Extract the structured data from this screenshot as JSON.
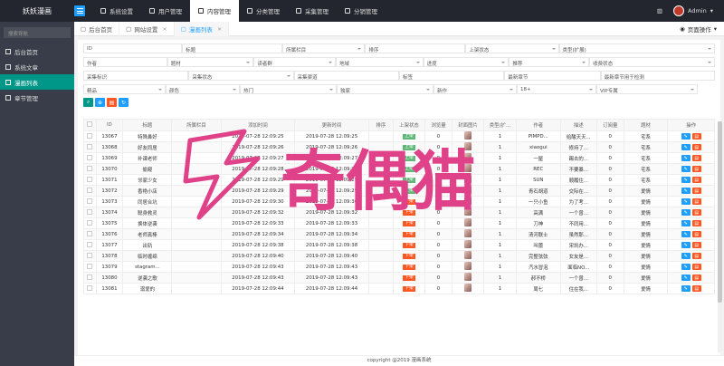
{
  "app": {
    "brand": "妖妖漫画",
    "user": "Admin",
    "footer": "copyright @2019 漫画系统"
  },
  "topnav": [
    {
      "label": "系统设置",
      "active": false
    },
    {
      "label": "用户管理",
      "active": false
    },
    {
      "label": "内容管理",
      "active": true
    },
    {
      "label": "分类管理",
      "active": false
    },
    {
      "label": "采集管理",
      "active": false
    },
    {
      "label": "分销管理",
      "active": false
    }
  ],
  "sidebar": {
    "search_placeholder": "搜索导航",
    "items": [
      {
        "label": "后台首页",
        "active": false
      },
      {
        "label": "系统文章",
        "active": false
      },
      {
        "label": "漫画列表",
        "active": true
      },
      {
        "label": "章节管理",
        "active": false
      }
    ]
  },
  "tabs": [
    {
      "label": "后台首页",
      "active": false
    },
    {
      "label": "网站设置",
      "active": false
    },
    {
      "label": "漫画列表",
      "active": true
    }
  ],
  "page_op": "页面操作",
  "filters": {
    "row1": [
      "ID",
      "标题",
      "所属栏目",
      "排序",
      "上架状态",
      "类型(扩展)"
    ],
    "row2": [
      "作者",
      "题材",
      "读者群",
      "地域",
      "进度",
      "推荐",
      "收费状态"
    ],
    "row3": [
      "采集标识",
      "采集状态",
      "采集渠道",
      "标签",
      "最新章节",
      "最新章节用于检测"
    ],
    "row4": [
      "精品",
      "颜色",
      "热门",
      "独家",
      "新作",
      "18+",
      "VIP专属"
    ]
  },
  "table": {
    "headers": [
      "",
      "ID",
      "标题",
      "所属栏目",
      "添加时间",
      "更新时间",
      "排序",
      "上架状态",
      "浏览量",
      "封面图片",
      "类型(扩...",
      "作者",
      "描述",
      "订阅量",
      "题材",
      "操作"
    ],
    "rows": [
      {
        "id": "13067",
        "title": "特殊鼻好",
        "add": "2019-07-28 12:09:25",
        "upd": "2019-07-28 12:09:25",
        "status": "上架",
        "on": true,
        "views": "0",
        "type": "1",
        "author": "PIMPD...",
        "desc": "给酸天天...",
        "subs": "0",
        "genre": "宅系"
      },
      {
        "id": "13068",
        "title": "好友同居",
        "add": "2019-07-28 12:09:26",
        "upd": "2019-07-28 12:09:26",
        "status": "上架",
        "on": true,
        "views": "0",
        "type": "1",
        "author": "xiaogui",
        "desc": "修持了...",
        "subs": "0",
        "genre": "宅系"
      },
      {
        "id": "13069",
        "title": "补课老师",
        "add": "2019-07-28 12:09:27",
        "upd": "2019-07-28 12:09:27",
        "status": "上架",
        "on": true,
        "views": "0",
        "type": "1",
        "author": "一屋",
        "desc": "踢击的...",
        "subs": "0",
        "genre": "宅系"
      },
      {
        "id": "13070",
        "title": "偷窥",
        "add": "2019-07-28 12:09:28",
        "upd": "2019-07-28 12:09:28",
        "status": "上架",
        "on": true,
        "views": "0",
        "type": "1",
        "author": "REC",
        "desc": "不要暴...",
        "subs": "0",
        "genre": "宅系"
      },
      {
        "id": "13071",
        "title": "邻家少女",
        "add": "2019-07-28 12:09:29",
        "upd": "2019-07-28 12:09:29",
        "status": "上架",
        "on": true,
        "views": "0",
        "type": "1",
        "author": "SUN",
        "desc": "顺履住...",
        "subs": "0",
        "genre": "宅系"
      },
      {
        "id": "13072",
        "title": "香艳小店",
        "add": "2019-07-28 12:09:29",
        "upd": "2019-07-28 12:09:29",
        "status": "上架",
        "on": true,
        "views": "0",
        "type": "1",
        "author": "青石胡道",
        "desc": "交际在...",
        "subs": "0",
        "genre": "爱情"
      },
      {
        "id": "13073",
        "title": "同居合坑",
        "add": "2019-07-28 12:09:30",
        "upd": "2019-07-28 12:09:30",
        "status": "下架",
        "on": false,
        "views": "0",
        "type": "1",
        "author": "一只小鱼",
        "desc": "为了考...",
        "subs": "0",
        "genre": "爱情"
      },
      {
        "id": "13074",
        "title": "聪身救灵",
        "add": "2019-07-28 12:09:32",
        "upd": "2019-07-28 12:09:32",
        "status": "下架",
        "on": false,
        "views": "0",
        "type": "1",
        "author": "高满",
        "desc": "一个曾...",
        "subs": "0",
        "genre": "爱情"
      },
      {
        "id": "13075",
        "title": "换体逆袭",
        "add": "2019-07-28 12:09:33",
        "upd": "2019-07-28 12:09:33",
        "status": "下架",
        "on": false,
        "views": "0",
        "type": "1",
        "author": "刀神",
        "desc": "不同用...",
        "subs": "0",
        "genre": "爱情"
      },
      {
        "id": "13076",
        "title": "老师真棒",
        "add": "2019-07-28 12:09:34",
        "upd": "2019-07-28 12:09:34",
        "status": "下架",
        "on": false,
        "views": "0",
        "type": "1",
        "author": "清河联士",
        "desc": "虽然那...",
        "subs": "0",
        "genre": "爱情"
      },
      {
        "id": "13077",
        "title": "出轨",
        "add": "2019-07-28 12:09:38",
        "upd": "2019-07-28 12:09:38",
        "status": "下架",
        "on": false,
        "views": "0",
        "type": "1",
        "author": "叫蕾",
        "desc": "宋凯办...",
        "subs": "0",
        "genre": "爱情"
      },
      {
        "id": "13078",
        "title": "临时缠绵",
        "add": "2019-07-28 12:09:40",
        "upd": "2019-07-28 12:09:40",
        "status": "下架",
        "on": false,
        "views": "0",
        "type": "1",
        "author": "完整弦弦",
        "desc": "女友是...",
        "subs": "0",
        "genre": "爱情"
      },
      {
        "id": "13079",
        "title": "stagram...",
        "add": "2019-07-28 12:09:43",
        "upd": "2019-07-28 12:09:43",
        "status": "下架",
        "on": false,
        "views": "0",
        "type": "1",
        "author": "汽水冒泡",
        "desc": "面临NO...",
        "subs": "0",
        "genre": "爱情"
      },
      {
        "id": "13080",
        "title": "逆袭之歌",
        "add": "2019-07-28 12:09:43",
        "upd": "2019-07-28 12:09:43",
        "status": "下架",
        "on": false,
        "views": "0",
        "type": "1",
        "author": "郝不桥",
        "desc": "一个曾...",
        "subs": "0",
        "genre": "爱情"
      },
      {
        "id": "13081",
        "title": "溺爱的",
        "add": "2019-07-28 12:09:44",
        "upd": "2019-07-28 12:09:44",
        "status": "下架",
        "on": false,
        "views": "0",
        "type": "1",
        "author": "周七",
        "desc": "住在我...",
        "subs": "0",
        "genre": "爱情"
      }
    ]
  },
  "watermark": "奇偶猫",
  "colors": {
    "accent": "#1e9fff",
    "green": "#009688",
    "success": "#5fb878",
    "danger": "#ff5722",
    "watermark": "#e0428a"
  }
}
